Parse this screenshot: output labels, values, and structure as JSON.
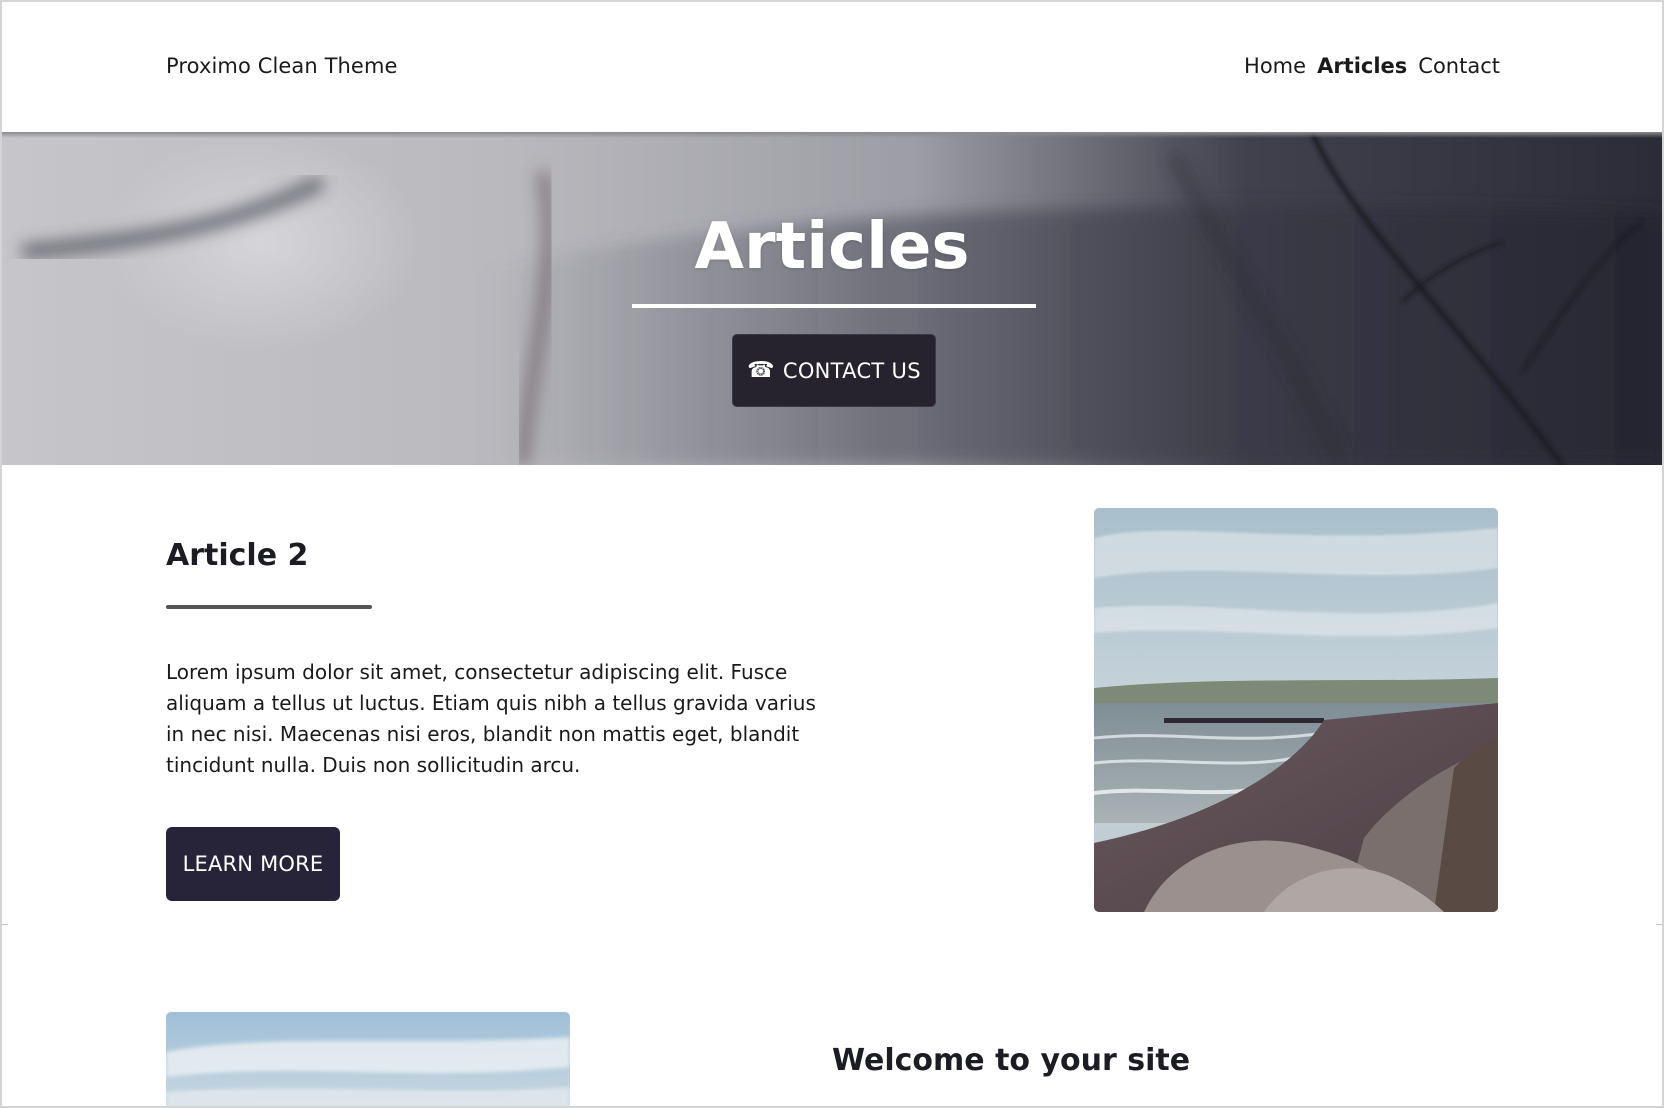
{
  "header": {
    "brand": "Proximo Clean Theme",
    "nav": [
      {
        "label": "Home",
        "active": false
      },
      {
        "label": "Articles",
        "active": true
      },
      {
        "label": "Contact",
        "active": false
      }
    ]
  },
  "hero": {
    "title": "Articles",
    "contact_button": {
      "icon": "phone-icon",
      "label": "CONTACT US"
    }
  },
  "article": {
    "title": "Article 2",
    "body": "Lorem ipsum dolor sit amet, consectetur adipiscing elit. Fusce aliquam a tellus ut luctus. Etiam quis nibh a tellus gravida varius in nec nisi. Maecenas nisi eros, blandit non mattis eget, blandit tincidunt nulla. Duis non sollicitudin arcu.",
    "button_label": "LEARN MORE"
  },
  "second_section": {
    "title": "Welcome to your site"
  },
  "colors": {
    "button_bg": "#27243a",
    "text": "#1c1c24",
    "background": "#ffffff"
  }
}
